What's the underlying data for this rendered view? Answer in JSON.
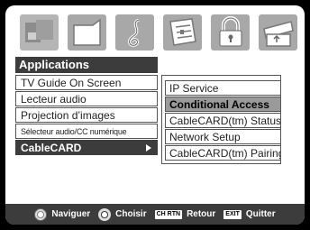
{
  "icons": [
    {
      "name": "picture-icon",
      "selected": true
    },
    {
      "name": "channel-icon",
      "selected": false
    },
    {
      "name": "audio-icon",
      "selected": false
    },
    {
      "name": "setup-icon",
      "selected": false
    },
    {
      "name": "lock-icon",
      "selected": false
    },
    {
      "name": "applications-icon",
      "selected": false
    }
  ],
  "applications": {
    "header": "Applications",
    "items": [
      {
        "label": "TV Guide On Screen"
      },
      {
        "label": "Lecteur audio"
      },
      {
        "label": "Projection d’images"
      },
      {
        "label": "Sélecteur audio/CC numérique"
      },
      {
        "label": "CableCARD"
      }
    ]
  },
  "cablecard_menu": {
    "items": [
      {
        "label": "IP Service"
      },
      {
        "label": "Conditional Access"
      },
      {
        "label": "CableCARD(tm) Status"
      },
      {
        "label": "Network Setup"
      },
      {
        "label": "CableCARD(tm) Pairing"
      }
    ]
  },
  "footer": {
    "navigate": "Naviguer",
    "select": "Choisir",
    "return_key": "CH RTN",
    "return": "Retour",
    "exit_key": "EXIT",
    "exit": "Quitter"
  },
  "colors": {
    "dark": "#3c3c3c",
    "highlight": "#9a9a9a",
    "icon": "#a8a8a8"
  }
}
